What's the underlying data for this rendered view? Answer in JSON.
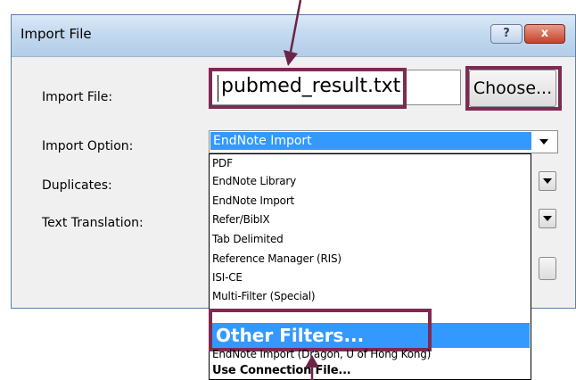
{
  "dialog": {
    "title": "Import File",
    "help_label": "?",
    "close_label": "x"
  },
  "form": {
    "import_file_label": "Import File:",
    "import_file_value": "pubmed_result.txt",
    "choose_label": "Choose...",
    "import_option_label": "Import Option:",
    "import_option_value": "EndNote Import",
    "duplicates_label": "Duplicates:",
    "text_translation_label": "Text Translation:"
  },
  "import_options": [
    "PDF",
    "EndNote Library",
    "EndNote Import",
    "Refer/BibIX",
    "Tab Delimited",
    "Reference Manager (RIS)",
    "ISI-CE",
    "Multi-Filter (Special)",
    "Other Filters...",
    "EndNote Import (Dragon, U of Hong Kong)",
    "Use Connection File..."
  ],
  "colors": {
    "highlight_border": "#7e2a53",
    "selection_blue": "#3399ff",
    "pointer_arrow": "#6b2547"
  },
  "icons": {
    "dropdown_arrow": "chevron-down-icon",
    "pointer": "arrow-pointer-icon"
  }
}
